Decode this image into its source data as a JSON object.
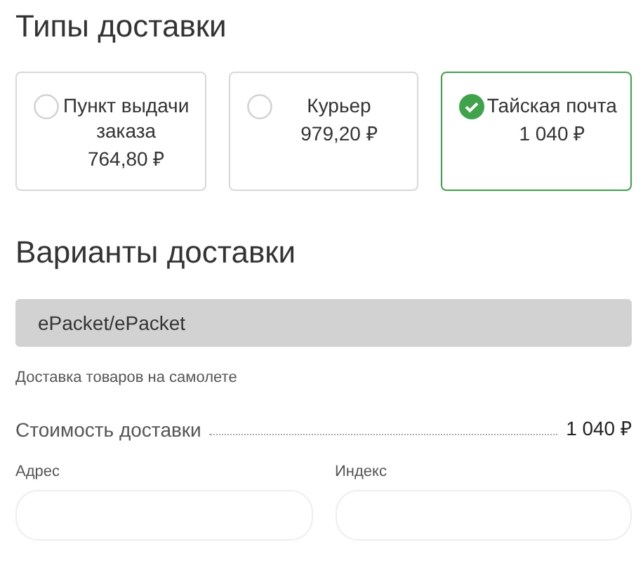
{
  "delivery_types": {
    "title": "Типы доставки",
    "options": [
      {
        "name": "Пункт выдачи заказа",
        "price": "764,80 ₽",
        "selected": false
      },
      {
        "name": "Курьер",
        "price": "979,20 ₽",
        "selected": false
      },
      {
        "name": "Тайская почта",
        "price": "1 040 ₽",
        "selected": true
      }
    ]
  },
  "delivery_variants": {
    "title": "Варианты доставки",
    "options": [
      {
        "name": "ePacket/ePacket",
        "selected": true
      }
    ],
    "description": "Доставка товаров на самолете",
    "cost": {
      "label": "Стоимость доставки",
      "value": "1 040 ₽"
    }
  },
  "fields": [
    {
      "label": "Адрес"
    },
    {
      "label": "Индекс"
    }
  ]
}
